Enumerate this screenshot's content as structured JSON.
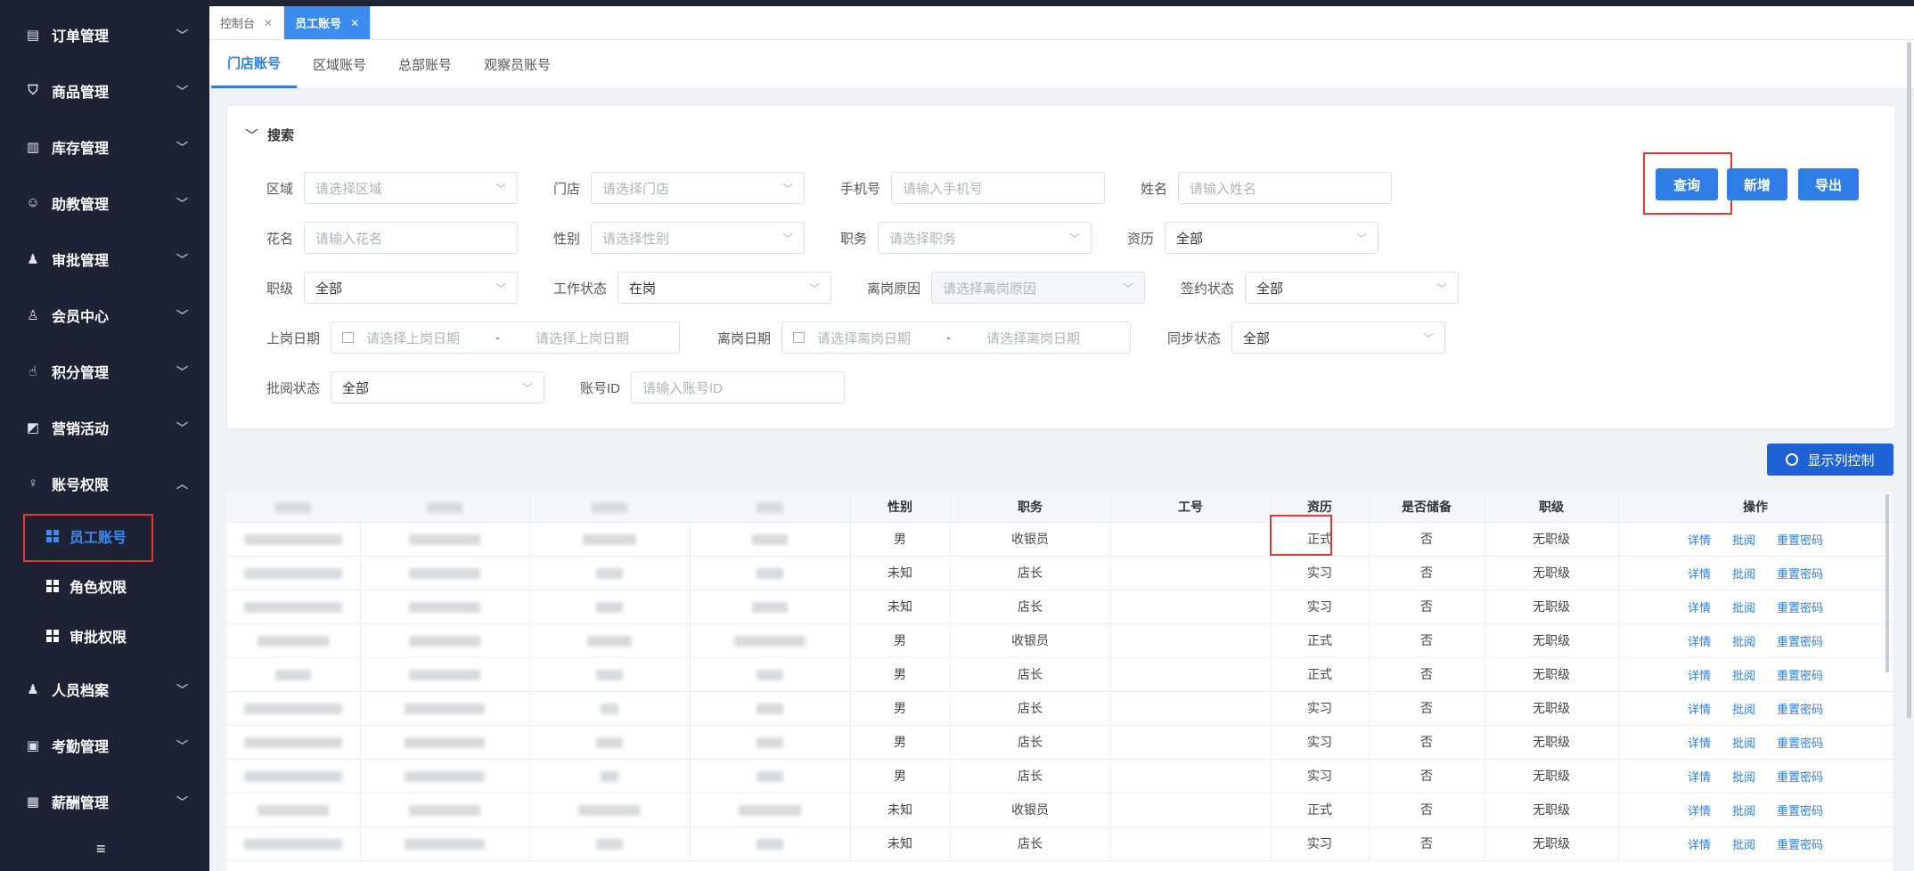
{
  "sidebar": {
    "items": [
      {
        "label": "订单管理",
        "icon": "document-icon"
      },
      {
        "label": "商品管理",
        "icon": "bag-icon"
      },
      {
        "label": "库存管理",
        "icon": "inventory-icon"
      },
      {
        "label": "助教管理",
        "icon": "person-icon"
      },
      {
        "label": "审批管理",
        "icon": "stamp-icon"
      },
      {
        "label": "会员中心",
        "icon": "member-icon"
      },
      {
        "label": "积分管理",
        "icon": "hand-icon"
      },
      {
        "label": "营销活动",
        "icon": "chart-icon"
      }
    ],
    "account": {
      "label": "账号权限",
      "icon": "user-icon"
    },
    "sub_items": [
      {
        "label": "员工账号"
      },
      {
        "label": "角色权限"
      },
      {
        "label": "审批权限"
      }
    ],
    "bottom_items": [
      {
        "label": "人员档案",
        "icon": "person-file-icon"
      },
      {
        "label": "考勤管理",
        "icon": "clipboard-icon"
      },
      {
        "label": "薪酬管理",
        "icon": "payroll-icon"
      }
    ]
  },
  "tabs": [
    {
      "label": "控制台"
    },
    {
      "label": "员工账号"
    }
  ],
  "subtabs": [
    {
      "label": "门店账号"
    },
    {
      "label": "区域账号"
    },
    {
      "label": "总部账号"
    },
    {
      "label": "观察员账号"
    }
  ],
  "search": {
    "title": "搜索",
    "area": {
      "label": "区域",
      "placeholder": "请选择区域"
    },
    "store": {
      "label": "门店",
      "placeholder": "请选择门店"
    },
    "phone": {
      "label": "手机号",
      "placeholder": "请输入手机号"
    },
    "name": {
      "label": "姓名",
      "placeholder": "请输入姓名"
    },
    "nickname": {
      "label": "花名",
      "placeholder": "请输入花名"
    },
    "gender": {
      "label": "性别",
      "placeholder": "请选择性别"
    },
    "position": {
      "label": "职务",
      "placeholder": "请选择职务"
    },
    "seniority": {
      "label": "资历",
      "value": "全部"
    },
    "rank": {
      "label": "职级",
      "value": "全部"
    },
    "work_status": {
      "label": "工作状态",
      "value": "在岗"
    },
    "leave_reason": {
      "label": "离岗原因",
      "placeholder": "请选择离岗原因"
    },
    "sign_status": {
      "label": "签约状态",
      "value": "全部"
    },
    "onboard_date": {
      "label": "上岗日期",
      "start": "请选择上岗日期",
      "sep": "-",
      "end": "请选择上岗日期"
    },
    "leave_date": {
      "label": "离岗日期",
      "start": "请选择离岗日期",
      "sep": "-",
      "end": "请选择离岗日期"
    },
    "sync_status": {
      "label": "同步状态",
      "value": "全部"
    },
    "review_status": {
      "label": "批阅状态",
      "value": "全部"
    },
    "account_id": {
      "label": "账号ID",
      "placeholder": "请输入账号ID"
    },
    "query_btn": "查询",
    "add_btn": "新增",
    "export_btn": "导出"
  },
  "column_control": "显示列控制",
  "table": {
    "headers": [
      "性别",
      "职务",
      "工号",
      "资历",
      "是否储备",
      "职级",
      "操作"
    ],
    "actions": [
      "详情",
      "批阅",
      "重置密码"
    ],
    "rows": [
      {
        "gender": "男",
        "position": "收银员",
        "seniority": "正式",
        "reserve": "否",
        "rank": "无职级"
      },
      {
        "gender": "未知",
        "position": "店长",
        "seniority": "实习",
        "reserve": "否",
        "rank": "无职级"
      },
      {
        "gender": "未知",
        "position": "店长",
        "seniority": "实习",
        "reserve": "否",
        "rank": "无职级"
      },
      {
        "gender": "男",
        "position": "收银员",
        "seniority": "正式",
        "reserve": "否",
        "rank": "无职级"
      },
      {
        "gender": "男",
        "position": "店长",
        "seniority": "正式",
        "reserve": "否",
        "rank": "无职级"
      },
      {
        "gender": "男",
        "position": "店长",
        "seniority": "实习",
        "reserve": "否",
        "rank": "无职级"
      },
      {
        "gender": "男",
        "position": "店长",
        "seniority": "实习",
        "reserve": "否",
        "rank": "无职级"
      },
      {
        "gender": "男",
        "position": "店长",
        "seniority": "实习",
        "reserve": "否",
        "rank": "无职级"
      },
      {
        "gender": "未知",
        "position": "收银员",
        "seniority": "正式",
        "reserve": "否",
        "rank": "无职级"
      },
      {
        "gender": "未知",
        "position": "店长",
        "seniority": "实习",
        "reserve": "否",
        "rank": "无职级"
      }
    ]
  }
}
